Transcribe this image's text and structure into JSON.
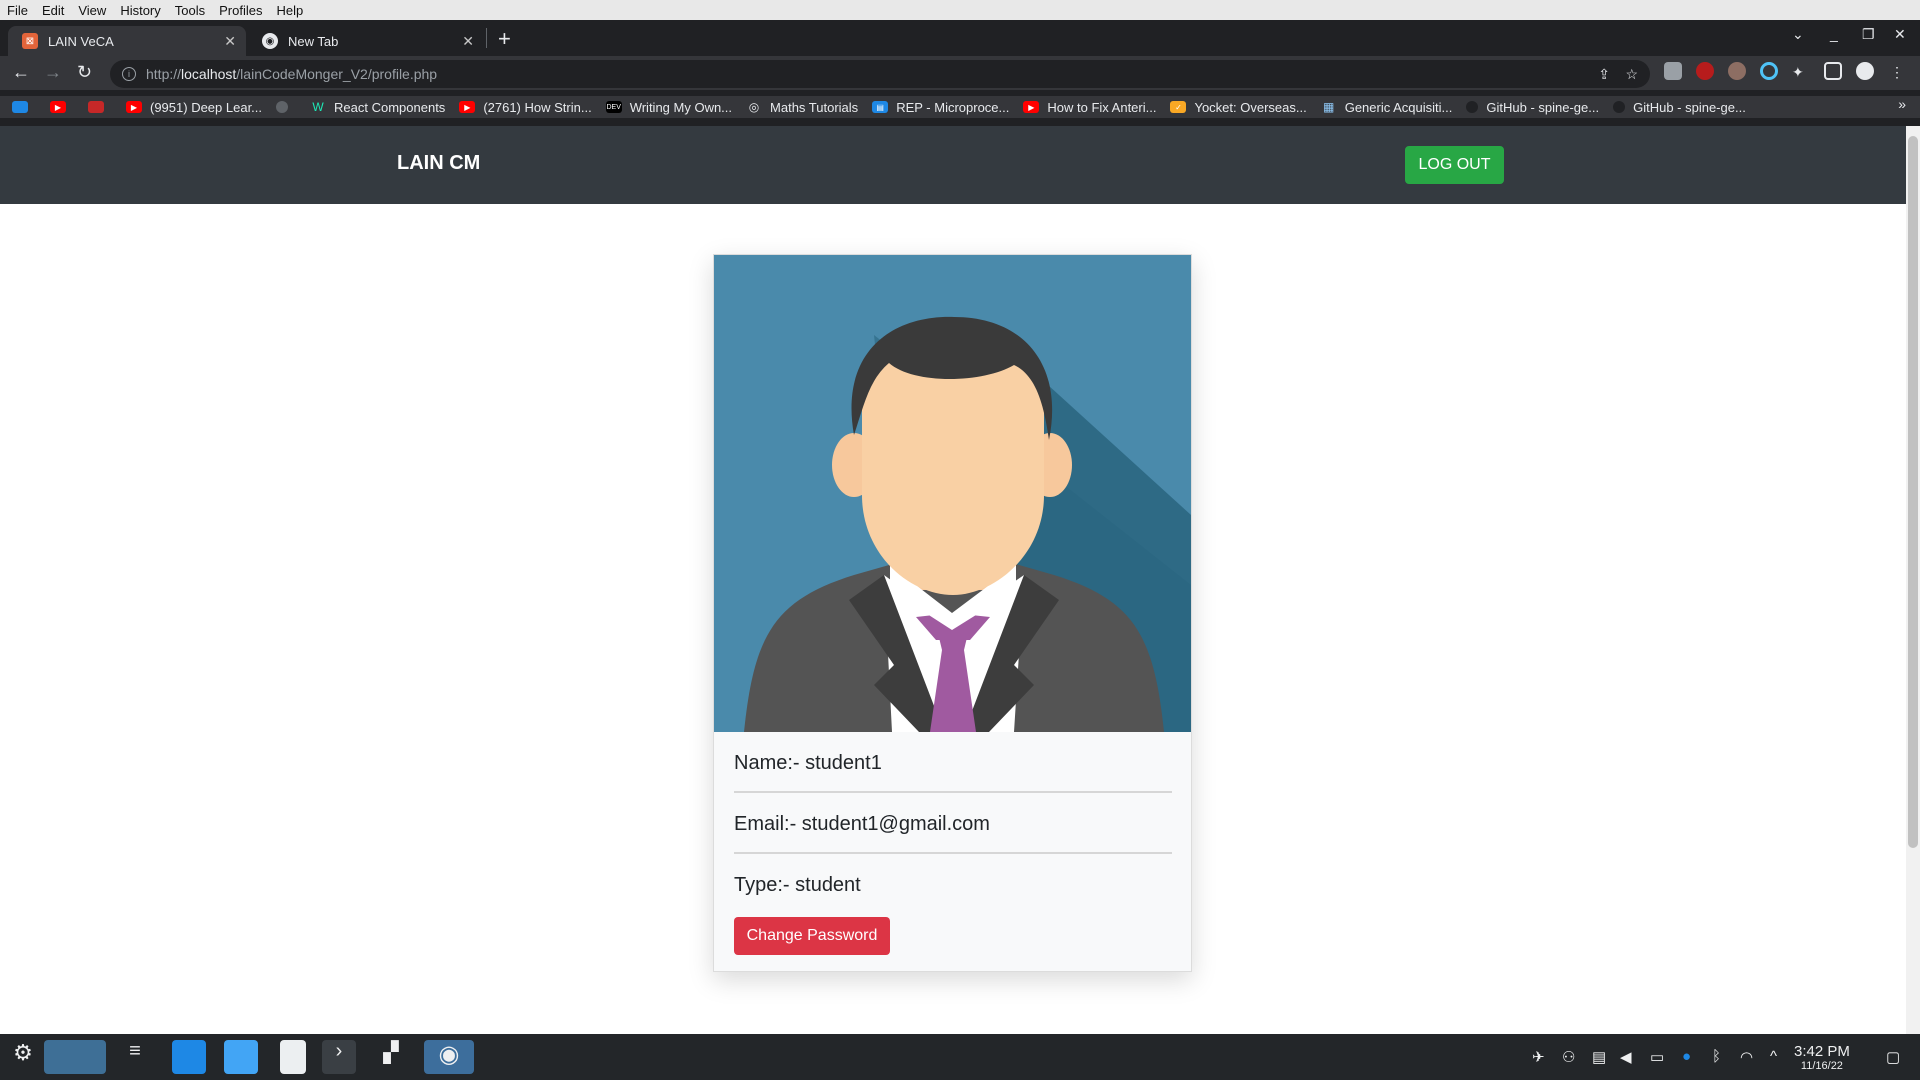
{
  "menubar": {
    "items": [
      "File",
      "Edit",
      "View",
      "History",
      "Tools",
      "Profiles",
      "Help"
    ]
  },
  "tabs": [
    {
      "title": "LAIN VeCA",
      "active": true
    },
    {
      "title": "New Tab",
      "active": false
    }
  ],
  "address_bar": {
    "scheme": "http://",
    "host": "localhost",
    "path": "/lainCodeMonger_V2/profile.php"
  },
  "bookmarks": [
    "(9951) Deep Lear...",
    "React Components",
    "(2761) How Strin...",
    "Writing My Own...",
    "Maths Tutorials",
    "REP - Microproce...",
    "How to Fix Anteri...",
    "Yocket: Overseas...",
    "Generic Acquisiti...",
    "GitHub - spine-ge...",
    "GitHub - spine-ge..."
  ],
  "app": {
    "brand": "LAIN CM",
    "logout_label": "LOG OUT"
  },
  "profile": {
    "name_line": "Name:- student1",
    "email_line": "Email:- student1@gmail.com",
    "type_line": "Type:- student",
    "change_password_label": "Change Password"
  },
  "taskbar": {
    "time": "3:42 PM",
    "date": "11/16/22"
  },
  "colors": {
    "navbar": "#343a40",
    "logout_button": "#28a745",
    "change_password_button": "#dc3545",
    "avatar_bg": "#4a8aab",
    "tie": "#a05aa0"
  }
}
